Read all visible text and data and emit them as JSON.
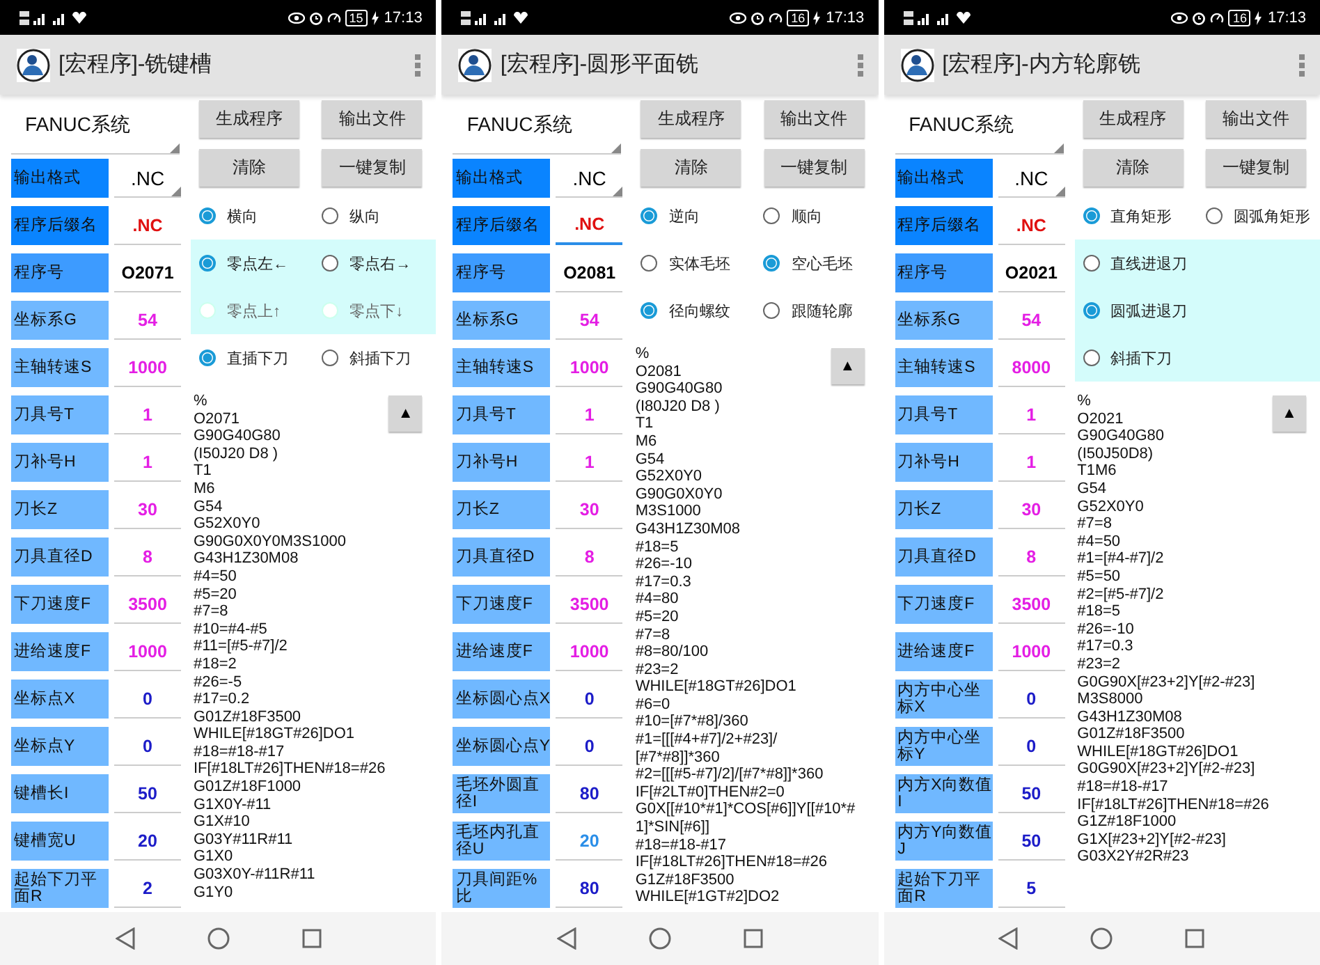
{
  "phones": [
    {
      "status_bar": {
        "battery": "15",
        "time": "17:13"
      },
      "title": "[宏程序]-铣键槽",
      "system": "FANUC系统",
      "buttons": [
        "生成程序",
        "输出文件",
        "清除",
        "一键复制"
      ],
      "params": [
        {
          "label": "输出格式",
          "value": ".NC",
          "kind": "dropdown",
          "color": "#000000",
          "focused": false
        },
        {
          "label": "程序后缀名",
          "value": ".NC",
          "kind": "text",
          "color": "#e01010",
          "focused": false
        },
        {
          "label": "程序号",
          "value": "O2071",
          "kind": "text",
          "color": "#000000",
          "focused": false
        },
        {
          "label": "坐标系G",
          "value": "54",
          "kind": "text",
          "color": "#e41ee4",
          "focused": false
        },
        {
          "label": "主轴转速S",
          "value": "1000",
          "kind": "text",
          "color": "#e41ee4",
          "focused": false
        },
        {
          "label": "刀具号T",
          "value": "1",
          "kind": "text",
          "color": "#e41ee4",
          "focused": false
        },
        {
          "label": "刀补号H",
          "value": "1",
          "kind": "text",
          "color": "#e41ee4",
          "focused": false
        },
        {
          "label": "刀长Z",
          "value": "30",
          "kind": "text",
          "color": "#e41ee4",
          "focused": false
        },
        {
          "label": "刀具直径D",
          "value": "8",
          "kind": "text",
          "color": "#e41ee4",
          "focused": false
        },
        {
          "label": "下刀速度F",
          "value": "3500",
          "kind": "text",
          "color": "#e41ee4",
          "focused": false
        },
        {
          "label": "进给速度F",
          "value": "1000",
          "kind": "text",
          "color": "#e41ee4",
          "focused": false
        },
        {
          "label": "坐标点X",
          "value": "0",
          "kind": "text",
          "color": "#1c1cc8",
          "focused": false
        },
        {
          "label": "坐标点Y",
          "value": "0",
          "kind": "text",
          "color": "#1c1cc8",
          "focused": false
        },
        {
          "label": "键槽长I",
          "value": "50",
          "kind": "text",
          "color": "#1c1cc8",
          "focused": false
        },
        {
          "label": "键槽宽U",
          "value": "20",
          "kind": "text",
          "color": "#1c1cc8",
          "focused": false
        },
        {
          "label": "起始下刀平面R",
          "value": "2",
          "kind": "text",
          "color": "#1c1cc8",
          "focused": false
        }
      ],
      "radio_groups": [
        {
          "highlighted": false,
          "options": [
            {
              "label": "横向",
              "selected": true,
              "disabled": false
            },
            {
              "label": "纵向",
              "selected": false,
              "disabled": false
            }
          ]
        },
        {
          "highlighted": true,
          "options": [
            {
              "label": "零点左←",
              "selected": true,
              "disabled": false
            },
            {
              "label": "零点右→",
              "selected": false,
              "disabled": false
            },
            {
              "label": "零点上↑",
              "selected": false,
              "disabled": true
            },
            {
              "label": "零点下↓",
              "selected": false,
              "disabled": true
            }
          ]
        },
        {
          "highlighted": false,
          "options": [
            {
              "label": "直插下刀",
              "selected": true,
              "disabled": false
            },
            {
              "label": "斜插下刀",
              "selected": false,
              "disabled": false
            }
          ]
        }
      ],
      "scroll_up": "▲",
      "code": [
        "%",
        "O2071",
        "G90G40G80",
        "(I50J20 D8 )",
        "T1",
        "M6",
        "G54",
        "G52X0Y0",
        "G90G0X0Y0M3S1000",
        "G43H1Z30M08",
        "#4=50",
        "#5=20",
        "#7=8",
        "#10=#4-#5",
        "#11=[#5-#7]/2",
        "#18=2",
        "#26=-5",
        "#17=0.2",
        "G01Z#18F3500",
        "WHILE[#18GT#26]DO1",
        "#18=#18-#17",
        "IF[#18LT#26]THEN#18=#26",
        "G01Z#18F1000",
        "G1X0Y-#11",
        "G1X#10",
        "G03Y#11R#11",
        "G1X0",
        "G03X0Y-#11R#11",
        "G1Y0"
      ]
    },
    {
      "status_bar": {
        "battery": "16",
        "time": "17:13"
      },
      "title": "[宏程序]-圆形平面铣",
      "system": "FANUC系统",
      "buttons": [
        "生成程序",
        "输出文件",
        "清除",
        "一键复制"
      ],
      "params": [
        {
          "label": "输出格式",
          "value": ".NC",
          "kind": "dropdown",
          "color": "#000000",
          "focused": false
        },
        {
          "label": "程序后缀名",
          "value": ".NC",
          "kind": "text",
          "color": "#e01010",
          "focused": true
        },
        {
          "label": "程序号",
          "value": "O2081",
          "kind": "text",
          "color": "#000000",
          "focused": false
        },
        {
          "label": "坐标系G",
          "value": "54",
          "kind": "text",
          "color": "#e41ee4",
          "focused": false
        },
        {
          "label": "主轴转速S",
          "value": "1000",
          "kind": "text",
          "color": "#e41ee4",
          "focused": false
        },
        {
          "label": "刀具号T",
          "value": "1",
          "kind": "text",
          "color": "#e41ee4",
          "focused": false
        },
        {
          "label": "刀补号H",
          "value": "1",
          "kind": "text",
          "color": "#e41ee4",
          "focused": false
        },
        {
          "label": "刀长Z",
          "value": "30",
          "kind": "text",
          "color": "#e41ee4",
          "focused": false
        },
        {
          "label": "刀具直径D",
          "value": "8",
          "kind": "text",
          "color": "#e41ee4",
          "focused": false
        },
        {
          "label": "下刀速度F",
          "value": "3500",
          "kind": "text",
          "color": "#e41ee4",
          "focused": false
        },
        {
          "label": "进给速度F",
          "value": "1000",
          "kind": "text",
          "color": "#e41ee4",
          "focused": false
        },
        {
          "label": "坐标圆心点X",
          "value": "0",
          "kind": "text",
          "color": "#1c1cc8",
          "focused": false
        },
        {
          "label": "坐标圆心点Y",
          "value": "0",
          "kind": "text",
          "color": "#1c1cc8",
          "focused": false
        },
        {
          "label": "毛坯外圆直径I",
          "value": "80",
          "kind": "text",
          "color": "#1c1cc8",
          "focused": false
        },
        {
          "label": "毛坯内孔直径U",
          "value": "20",
          "kind": "text",
          "color": "#2a8ee8",
          "focused": false
        },
        {
          "label": "刀具间距%比",
          "value": "80",
          "kind": "text",
          "color": "#1c1cc8",
          "focused": false
        }
      ],
      "radio_groups": [
        {
          "highlighted": false,
          "options": [
            {
              "label": "逆向",
              "selected": true,
              "disabled": false
            },
            {
              "label": "顺向",
              "selected": false,
              "disabled": false
            }
          ]
        },
        {
          "highlighted": false,
          "options": [
            {
              "label": "实体毛坯",
              "selected": false,
              "disabled": false
            },
            {
              "label": "空心毛坯",
              "selected": true,
              "disabled": false
            }
          ]
        },
        {
          "highlighted": false,
          "options": [
            {
              "label": "径向螺纹",
              "selected": true,
              "disabled": false
            },
            {
              "label": "跟随轮廓",
              "selected": false,
              "disabled": false
            }
          ]
        }
      ],
      "scroll_up": "▲",
      "code": [
        "%",
        "O2081",
        "G90G40G80",
        "(I80J20 D8 )",
        "T1",
        "M6",
        "G54",
        "G52X0Y0",
        "G90G0X0Y0",
        "M3S1000",
        "G43H1Z30M08",
        "#18=5",
        "#26=-10",
        "#17=0.3",
        "#4=80",
        "#5=20",
        "#7=8",
        "#8=80/100",
        "#23=2",
        "WHILE[#18GT#26]DO1",
        "#6=0",
        "#10=[#7*#8]/360",
        "#1=[[[#4+#7]/2+#23]/",
        "[#7*#8]]*360",
        "#2=[[[#5-#7]/2]/[#7*#8]]*360",
        "IF[#2LT#0]THEN#2=0",
        "G0X[[#10*#1]*COS[#6]]Y[[#10*#",
        "1]*SIN[#6]]",
        "#18=#18-#17",
        "IF[#18LT#26]THEN#18=#26",
        "G1Z#18F3500",
        "WHILE[#1GT#2]DO2"
      ]
    },
    {
      "status_bar": {
        "battery": "16",
        "time": "17:13"
      },
      "title": "[宏程序]-内方轮廓铣",
      "system": "FANUC系统",
      "buttons": [
        "生成程序",
        "输出文件",
        "清除",
        "一键复制"
      ],
      "params": [
        {
          "label": "输出格式",
          "value": ".NC",
          "kind": "dropdown",
          "color": "#000000",
          "focused": false
        },
        {
          "label": "程序后缀名",
          "value": ".NC",
          "kind": "text",
          "color": "#e01010",
          "focused": false
        },
        {
          "label": "程序号",
          "value": "O2021",
          "kind": "text",
          "color": "#000000",
          "focused": false
        },
        {
          "label": "坐标系G",
          "value": "54",
          "kind": "text",
          "color": "#e41ee4",
          "focused": false
        },
        {
          "label": "主轴转速S",
          "value": "8000",
          "kind": "text",
          "color": "#e41ee4",
          "focused": false
        },
        {
          "label": "刀具号T",
          "value": "1",
          "kind": "text",
          "color": "#e41ee4",
          "focused": false
        },
        {
          "label": "刀补号H",
          "value": "1",
          "kind": "text",
          "color": "#e41ee4",
          "focused": false
        },
        {
          "label": "刀长Z",
          "value": "30",
          "kind": "text",
          "color": "#e41ee4",
          "focused": false
        },
        {
          "label": "刀具直径D",
          "value": "8",
          "kind": "text",
          "color": "#e41ee4",
          "focused": false
        },
        {
          "label": "下刀速度F",
          "value": "3500",
          "kind": "text",
          "color": "#e41ee4",
          "focused": false
        },
        {
          "label": "进给速度F",
          "value": "1000",
          "kind": "text",
          "color": "#e41ee4",
          "focused": false
        },
        {
          "label": "内方中心坐标X",
          "value": "0",
          "kind": "text",
          "color": "#1c1cc8",
          "focused": false
        },
        {
          "label": "内方中心坐标Y",
          "value": "0",
          "kind": "text",
          "color": "#1c1cc8",
          "focused": false
        },
        {
          "label": "内方X向数值I",
          "value": "50",
          "kind": "text",
          "color": "#1c1cc8",
          "focused": false
        },
        {
          "label": "内方Y向数值J",
          "value": "50",
          "kind": "text",
          "color": "#1c1cc8",
          "focused": false
        },
        {
          "label": "起始下刀平面R",
          "value": "5",
          "kind": "text",
          "color": "#1c1cc8",
          "focused": false
        }
      ],
      "radio_groups": [
        {
          "highlighted": false,
          "options": [
            {
              "label": "直角矩形",
              "selected": true,
              "disabled": false
            },
            {
              "label": "圆弧角矩形",
              "selected": false,
              "disabled": false
            }
          ]
        },
        {
          "highlighted": true,
          "options": [
            {
              "label": "直线进退刀",
              "selected": false,
              "disabled": false
            },
            {
              "label": "圆弧进退刀",
              "selected": true,
              "disabled": false
            },
            {
              "label": "斜插下刀",
              "selected": false,
              "disabled": false
            }
          ]
        }
      ],
      "scroll_up": "▲",
      "code": [
        "%",
        "O2021",
        "G90G40G80",
        "(I50J50D8)",
        "T1M6",
        "G54",
        "G52X0Y0",
        "#7=8",
        "#4=50",
        "#1=[#4-#7]/2",
        "#5=50",
        "#2=[#5-#7]/2",
        "#18=5",
        "#26=-10",
        "#17=0.3",
        "#23=2",
        "G0G90X[#23+2]Y[#2-#23]",
        "M3S8000",
        "G43H1Z30M08",
        "G01Z#18F3500",
        "WHILE[#18GT#26]DO1",
        "G0G90X[#23+2]Y[#2-#23]",
        "#18=#18-#17",
        "IF[#18LT#26]THEN#18=#26",
        "G1Z#18F1000",
        "G1X[#23+2]Y[#2-#23]",
        "G03X2Y#2R#23"
      ]
    }
  ]
}
